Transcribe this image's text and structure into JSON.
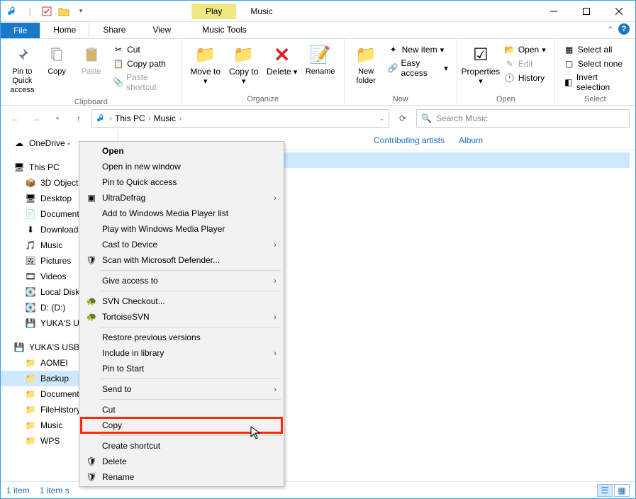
{
  "window": {
    "title": "Music",
    "play_tab": "Play"
  },
  "tabs": {
    "file": "File",
    "home": "Home",
    "share": "Share",
    "view": "View",
    "music_tools": "Music Tools"
  },
  "ribbon": {
    "clipboard": {
      "label": "Clipboard",
      "pin": "Pin to Quick access",
      "copy": "Copy",
      "paste": "Paste",
      "cut": "Cut",
      "copy_path": "Copy path",
      "paste_shortcut": "Paste shortcut"
    },
    "organize": {
      "label": "Organize",
      "move_to": "Move to",
      "copy_to": "Copy to",
      "delete": "Delete",
      "rename": "Rename"
    },
    "new": {
      "label": "New",
      "new_folder": "New folder",
      "new_item": "New item",
      "easy_access": "Easy access"
    },
    "open": {
      "label": "Open",
      "properties": "Properties",
      "open": "Open",
      "edit": "Edit",
      "history": "History"
    },
    "select": {
      "label": "Select",
      "select_all": "Select all",
      "select_none": "Select none",
      "invert": "Invert selection"
    }
  },
  "address": {
    "this_pc": "This PC",
    "music": "Music",
    "search_placeholder": "Search Music"
  },
  "tree": {
    "onedrive": "OneDrive - ",
    "this_pc": "This PC",
    "items": [
      "3D Objects",
      "Desktop",
      "Documents",
      "Downloads",
      "Music",
      "Pictures",
      "Videos",
      "Local Disk",
      "D: (D:)",
      "YUKA'S US"
    ],
    "usb": "YUKA'S USB",
    "usb_items": [
      "AOMEI",
      "Backup",
      "Documents",
      "FileHistory",
      "Music",
      "WPS"
    ]
  },
  "columns": {
    "contrib": "Contributing artists",
    "album": "Album"
  },
  "context_menu": {
    "open": "Open",
    "open_new": "Open in new window",
    "pin_qa": "Pin to Quick access",
    "ultradefrag": "UltraDefrag",
    "add_wmp": "Add to Windows Media Player list",
    "play_wmp": "Play with Windows Media Player",
    "cast": "Cast to Device",
    "scan": "Scan with Microsoft Defender...",
    "give_access": "Give access to",
    "svn_checkout": "SVN Checkout...",
    "tortoise": "TortoiseSVN",
    "restore": "Restore previous versions",
    "include": "Include in library",
    "pin_start": "Pin to Start",
    "send_to": "Send to",
    "cut": "Cut",
    "copy": "Copy",
    "shortcut": "Create shortcut",
    "delete": "Delete",
    "rename": "Rename"
  },
  "status": {
    "count": "1 item",
    "selected": "1 item s"
  }
}
